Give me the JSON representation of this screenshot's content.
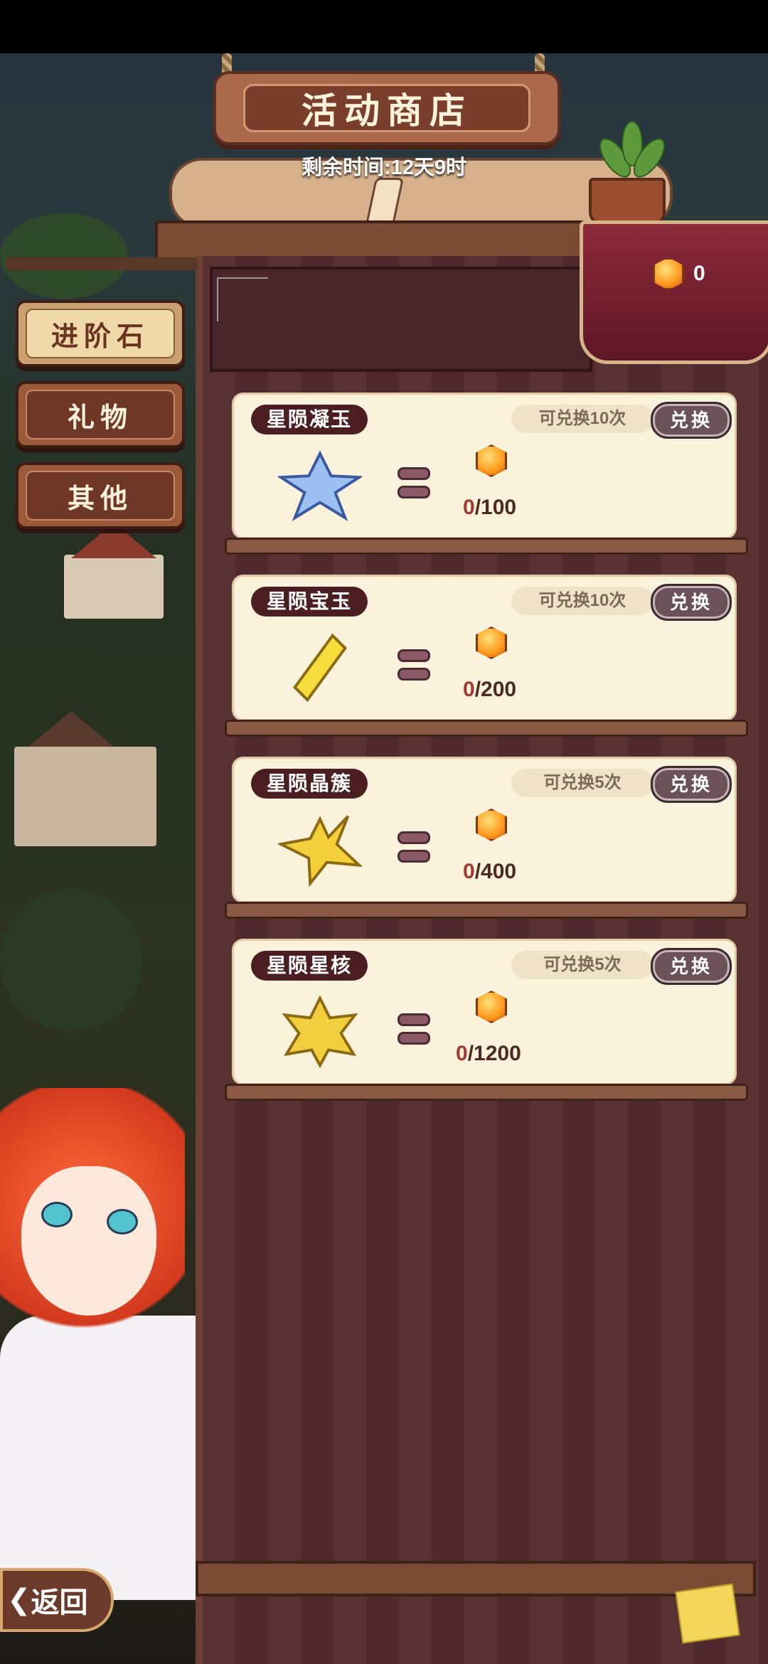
{
  "shop": {
    "title": "活动商店",
    "timer": "剩余时间:12天9时"
  },
  "currency": {
    "icon": "orange-gem-icon",
    "count": "0"
  },
  "tabs": [
    {
      "label": "进阶石",
      "active": true
    },
    {
      "label": "礼物",
      "active": false
    },
    {
      "label": "其他",
      "active": false
    }
  ],
  "items": [
    {
      "name": "星陨凝玉",
      "limit": "可兑换10次",
      "button": "兑换",
      "have": "0",
      "need": "/100",
      "crystal_color": "#8fb6f0"
    },
    {
      "name": "星陨宝玉",
      "limit": "可兑换10次",
      "button": "兑换",
      "have": "0",
      "need": "/200",
      "crystal_color": "#f6dd3c"
    },
    {
      "name": "星陨晶簇",
      "limit": "可兑换5次",
      "button": "兑换",
      "have": "0",
      "need": "/400",
      "crystal_color": "#f4d13a"
    },
    {
      "name": "星陨星核",
      "limit": "可兑换5次",
      "button": "兑换",
      "have": "0",
      "need": "/1200",
      "crystal_color": "#f2cf3e"
    }
  ],
  "back": {
    "label": "返回"
  }
}
